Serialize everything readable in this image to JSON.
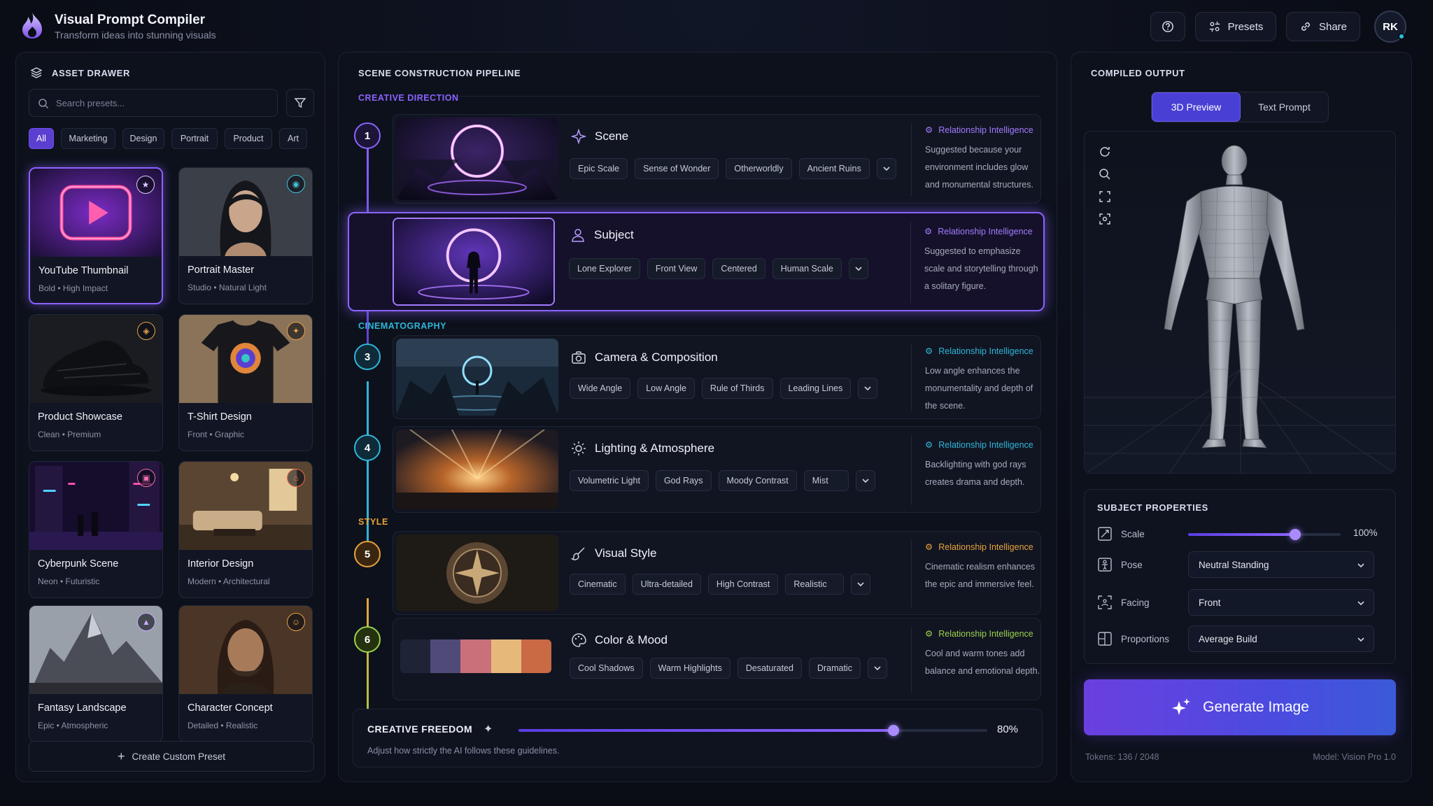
{
  "app": {
    "title": "Visual Prompt Compiler",
    "subtitle": "Transform ideas into stunning visuals"
  },
  "header": {
    "presets_label": "Presets",
    "share_label": "Share",
    "avatar_initials": "RK"
  },
  "asset_drawer": {
    "title": "ASSET DRAWER",
    "search_placeholder": "Search presets...",
    "filters": [
      "All",
      "Marketing",
      "Design",
      "Portrait",
      "Product",
      "Art"
    ],
    "active_filter": "All",
    "presets": [
      {
        "name": "YouTube Thumbnail",
        "tags": "Bold  •  High Impact",
        "badge_color": "#d9c8ff",
        "badge_icon": "star-icon",
        "badge_glyph": "★"
      },
      {
        "name": "Portrait Master",
        "tags": "Studio  •  Natural Light",
        "badge_color": "#3fc6dc",
        "badge_icon": "camera-icon",
        "badge_glyph": "◉"
      },
      {
        "name": "Product Showcase",
        "tags": "Clean  •  Premium",
        "badge_color": "#e8a34a",
        "badge_icon": "box-icon",
        "badge_glyph": "◈"
      },
      {
        "name": "T-Shirt Design",
        "tags": "Front  •  Graphic",
        "badge_color": "#e8a34a",
        "badge_icon": "shirt-icon",
        "badge_glyph": "✦"
      },
      {
        "name": "Cyberpunk Scene",
        "tags": "Neon  •  Futuristic",
        "badge_color": "#ef6fb0",
        "badge_icon": "city-icon",
        "badge_glyph": "▣"
      },
      {
        "name": "Interior Design",
        "tags": "Modern  •  Architectural",
        "badge_color": "#ef6a4a",
        "badge_icon": "home-icon",
        "badge_glyph": "⌂"
      },
      {
        "name": "Fantasy Landscape",
        "tags": "Epic  •  Atmospheric",
        "badge_color": "#c7a8ff",
        "badge_icon": "mountain-icon",
        "badge_glyph": "▲"
      },
      {
        "name": "Character Concept",
        "tags": "Detailed  •  Realistic",
        "badge_color": "#e8a34a",
        "badge_icon": "person-icon",
        "badge_glyph": "☺"
      }
    ],
    "create_label": "Create Custom Preset"
  },
  "pipeline": {
    "title": "SCENE CONSTRUCTION PIPELINE",
    "sections": {
      "creative": "CREATIVE DIRECTION",
      "cinema": "CINEMATOGRAPHY",
      "style": "STYLE"
    },
    "section_colors": {
      "creative": "#8b63ff",
      "cinema": "#2fb6d8",
      "style": "#e8a23a",
      "mood": "#9bd04a"
    },
    "rel_label": "Relationship Intelligence",
    "steps": [
      {
        "num": "1",
        "title": "Scene",
        "icon": "sparkle-icon",
        "tags": [
          "Epic Scale",
          "Sense of Wonder",
          "Otherworldly",
          "Ancient Ruins"
        ],
        "rel_text": "Suggested because your environment includes glow and monumental structures."
      },
      {
        "num": "2",
        "title": "Subject",
        "icon": "user-icon",
        "tags": [
          "Lone Explorer",
          "Front View",
          "Centered",
          "Human Scale"
        ],
        "rel_text": "Suggested to emphasize scale and storytelling through a solitary figure."
      },
      {
        "num": "3",
        "title": "Camera & Composition",
        "icon": "camera-icon",
        "tags": [
          "Wide Angle",
          "Low Angle",
          "Rule of Thirds",
          "Leading Lines"
        ],
        "rel_text": "Low angle enhances the monumentality and depth of the scene."
      },
      {
        "num": "4",
        "title": "Lighting & Atmosphere",
        "icon": "sun-icon",
        "tags": [
          "Volumetric Light",
          "God Rays",
          "Moody Contrast",
          "Mist"
        ],
        "rel_text": "Backlighting with god rays creates drama and depth."
      },
      {
        "num": "5",
        "title": "Visual Style",
        "icon": "brush-icon",
        "tags": [
          "Cinematic",
          "Ultra-detailed",
          "High Contrast",
          "Realistic"
        ],
        "rel_text": "Cinematic realism enhances the epic and immersive feel."
      },
      {
        "num": "6",
        "title": "Color & Mood",
        "icon": "palette-icon",
        "tags": [
          "Cool Shadows",
          "Warm Highlights",
          "Desaturated",
          "Dramatic"
        ],
        "rel_text": "Cool and warm tones add balance and emotional depth."
      }
    ],
    "palette": [
      "#1f2336",
      "#4f4a78",
      "#c9707a",
      "#e6b97a",
      "#c96a45"
    ],
    "freedom": {
      "title": "CREATIVE FREEDOM",
      "value_label": "80%",
      "value": 0.8,
      "hint": "Adjust how strictly the AI follows these guidelines."
    }
  },
  "output": {
    "title": "COMPILED OUTPUT",
    "tabs": [
      "3D Preview",
      "Text Prompt"
    ],
    "active_tab": "3D Preview",
    "subject_props_title": "SUBJECT PROPERTIES",
    "scale_label": "Scale",
    "scale_value_label": "100%",
    "scale_value": 0.7,
    "pose_label": "Pose",
    "pose_value": "Neutral Standing",
    "facing_label": "Facing",
    "facing_value": "Front",
    "proportions_label": "Proportions",
    "proportions_value": "Average Build",
    "generate_label": "Generate Image",
    "tokens": "Tokens: 136 / 2048",
    "model": "Model: Vision Pro 1.0"
  }
}
